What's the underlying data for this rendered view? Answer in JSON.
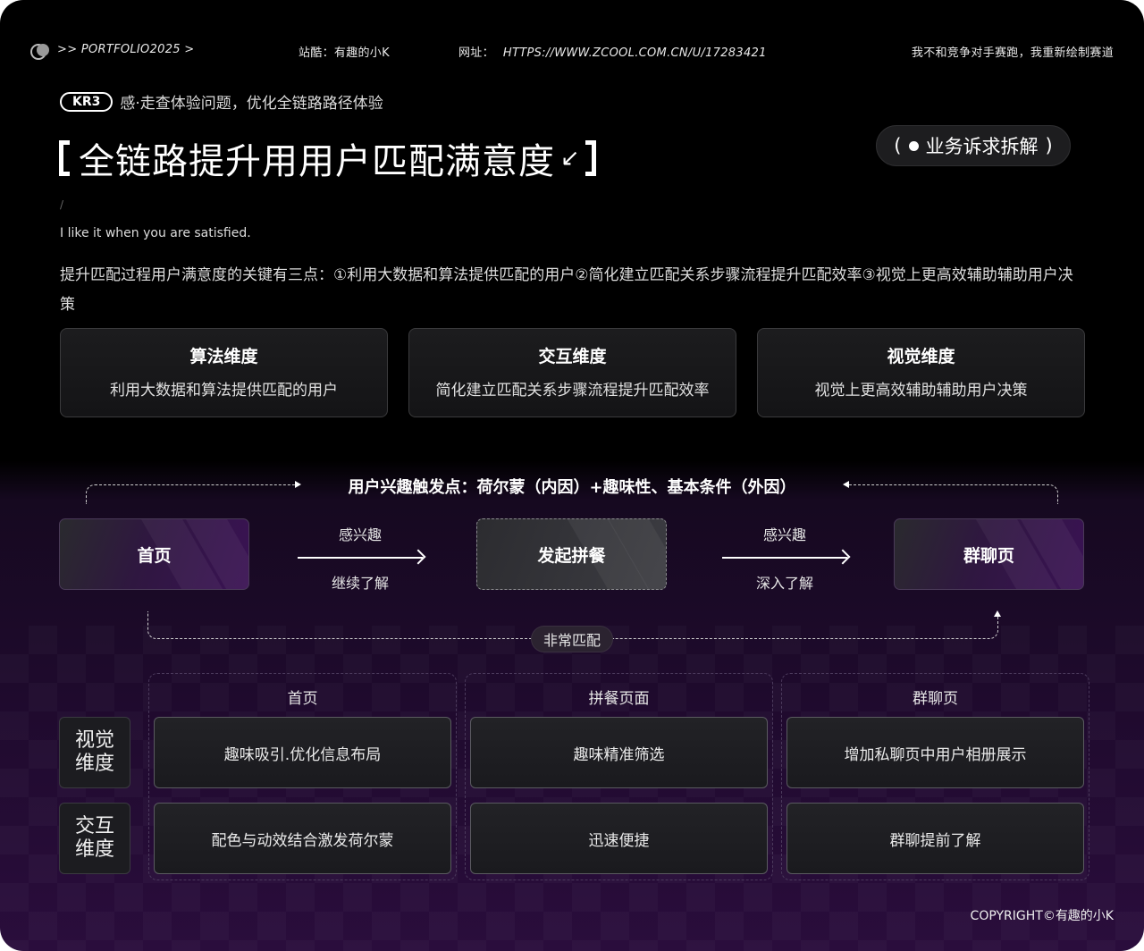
{
  "header": {
    "portfolio": ">> PORTFOLIO2025 >",
    "station": "站酷：有趣的小K",
    "url_label": "网址：",
    "url": "HTTPS://WWW.ZCOOL.COM.CN/U/17283421",
    "slogan": "我不和竞争对手赛跑，我重新绘制赛道"
  },
  "kr": {
    "badge": "KR3",
    "text": "感·走查体验问题，优化全链路路径体验"
  },
  "title": "全链路提升用用户匹配满意度",
  "tag": "业务诉求拆解",
  "slash": "/",
  "subtitle": "I like it when you are satisfied.",
  "description": "提升匹配过程用户满意度的关键有三点：①利用大数据和算法提供匹配的用户②简化建立匹配关系步骤流程提升匹配效率③视觉上更高效辅助辅助用户决策",
  "dimensions": [
    {
      "title": "算法维度",
      "desc": "利用大数据和算法提供匹配的用户"
    },
    {
      "title": "交互维度",
      "desc": "简化建立匹配关系步骤流程提升匹配效率"
    },
    {
      "title": "视觉维度",
      "desc": "视觉上更高效辅助辅助用户决策"
    }
  ],
  "flow": {
    "trigger": "用户兴趣触发点：荷尔蒙（内因）+趣味性、基本条件（外因）",
    "nodes": [
      "首页",
      "发起拼餐",
      "群聊页"
    ],
    "arrows": [
      {
        "top": "感兴趣",
        "bottom": "继续了解"
      },
      {
        "top": "感兴趣",
        "bottom": "深入了解"
      }
    ],
    "match": "非常匹配"
  },
  "matrix": {
    "columns": [
      "首页",
      "拼餐页面",
      "群聊页"
    ],
    "rows": [
      {
        "label": "视觉维度",
        "cells": [
          "趣味吸引.优化信息布局",
          "趣味精准筛选",
          "增加私聊页中用户相册展示"
        ]
      },
      {
        "label": "交互维度",
        "cells": [
          "配色与动效结合激发荷尔蒙",
          "迅速便捷",
          "群聊提前了解"
        ]
      }
    ]
  },
  "copyright": "COPYRIGHT©有趣的小K"
}
